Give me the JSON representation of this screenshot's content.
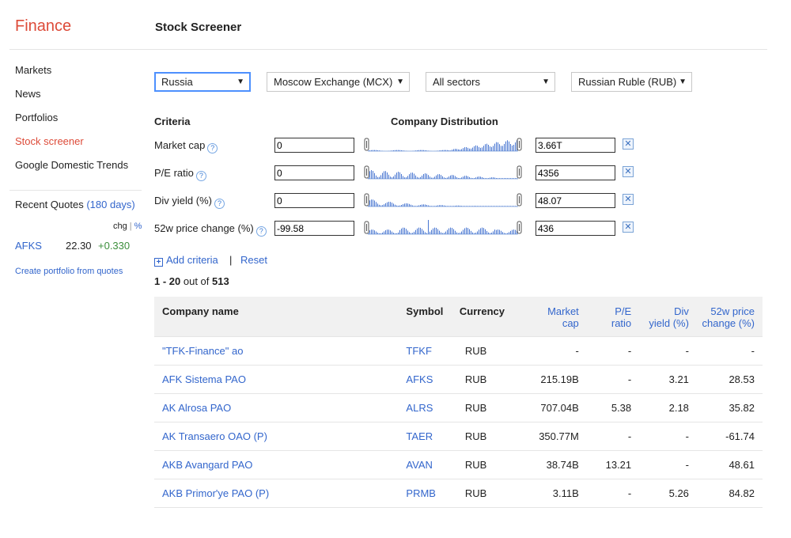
{
  "app": {
    "brand": "Finance",
    "title": "Stock Screener"
  },
  "sidebar": {
    "items": [
      {
        "label": "Markets",
        "active": false
      },
      {
        "label": "News",
        "active": false
      },
      {
        "label": "Portfolios",
        "active": false
      },
      {
        "label": "Stock screener",
        "active": true
      },
      {
        "label": "Google Domestic Trends",
        "active": false
      }
    ],
    "recent": {
      "title": "Recent Quotes",
      "period": "(180 days)",
      "chg_label": "chg",
      "sep": "|",
      "pct_label": "%",
      "quotes": [
        {
          "symbol": "AFKS",
          "price": "22.30",
          "change": "+0.330"
        }
      ],
      "create_link": "Create portfolio from quotes"
    }
  },
  "filters": {
    "country": "Russia",
    "exchange": "Moscow Exchange (MCX)",
    "sector": "All sectors",
    "currency": "Russian Ruble (RUB)"
  },
  "criteria": {
    "header": "Criteria",
    "dist_header": "Company Distribution",
    "rows": [
      {
        "label": "Market cap",
        "min": "0",
        "max": "3.66T"
      },
      {
        "label": "P/E ratio",
        "min": "0",
        "max": "4356"
      },
      {
        "label": "Div yield (%)",
        "min": "0",
        "max": "48.07"
      },
      {
        "label": "52w price change (%)",
        "min": "-99.58",
        "max": "436"
      }
    ],
    "add_label": "Add criteria",
    "pipe": "|",
    "reset_label": "Reset"
  },
  "results": {
    "range": "1 - 20",
    "of_label": "out of",
    "total": "513",
    "columns": {
      "name": "Company name",
      "symbol": "Symbol",
      "currency": "Currency",
      "mcap_1": "Market",
      "mcap_2": "cap",
      "pe_1": "P/E",
      "pe_2": "ratio",
      "div_1": "Div",
      "div_2": "yield (%)",
      "chg_1": "52w price",
      "chg_2": "change (%)"
    },
    "rows": [
      {
        "name": "\"TFK-Finance\" ao",
        "symbol": "TFKF",
        "currency": "RUB",
        "mcap": "-",
        "pe": "-",
        "div": "-",
        "chg52": "-"
      },
      {
        "name": "AFK Sistema PAO",
        "symbol": "AFKS",
        "currency": "RUB",
        "mcap": "215.19B",
        "pe": "-",
        "div": "3.21",
        "chg52": "28.53"
      },
      {
        "name": "AK Alrosa PAO",
        "symbol": "ALRS",
        "currency": "RUB",
        "mcap": "707.04B",
        "pe": "5.38",
        "div": "2.18",
        "chg52": "35.82"
      },
      {
        "name": "AK Transaero OAO (P)",
        "symbol": "TAER",
        "currency": "RUB",
        "mcap": "350.77M",
        "pe": "-",
        "div": "-",
        "chg52": "-61.74"
      },
      {
        "name": "AKB Avangard PAO",
        "symbol": "AVAN",
        "currency": "RUB",
        "mcap": "38.74B",
        "pe": "13.21",
        "div": "-",
        "chg52": "48.61"
      },
      {
        "name": "AKB Primor'ye PAO (P)",
        "symbol": "PRMB",
        "currency": "RUB",
        "mcap": "3.11B",
        "pe": "-",
        "div": "5.26",
        "chg52": "84.82"
      }
    ]
  }
}
